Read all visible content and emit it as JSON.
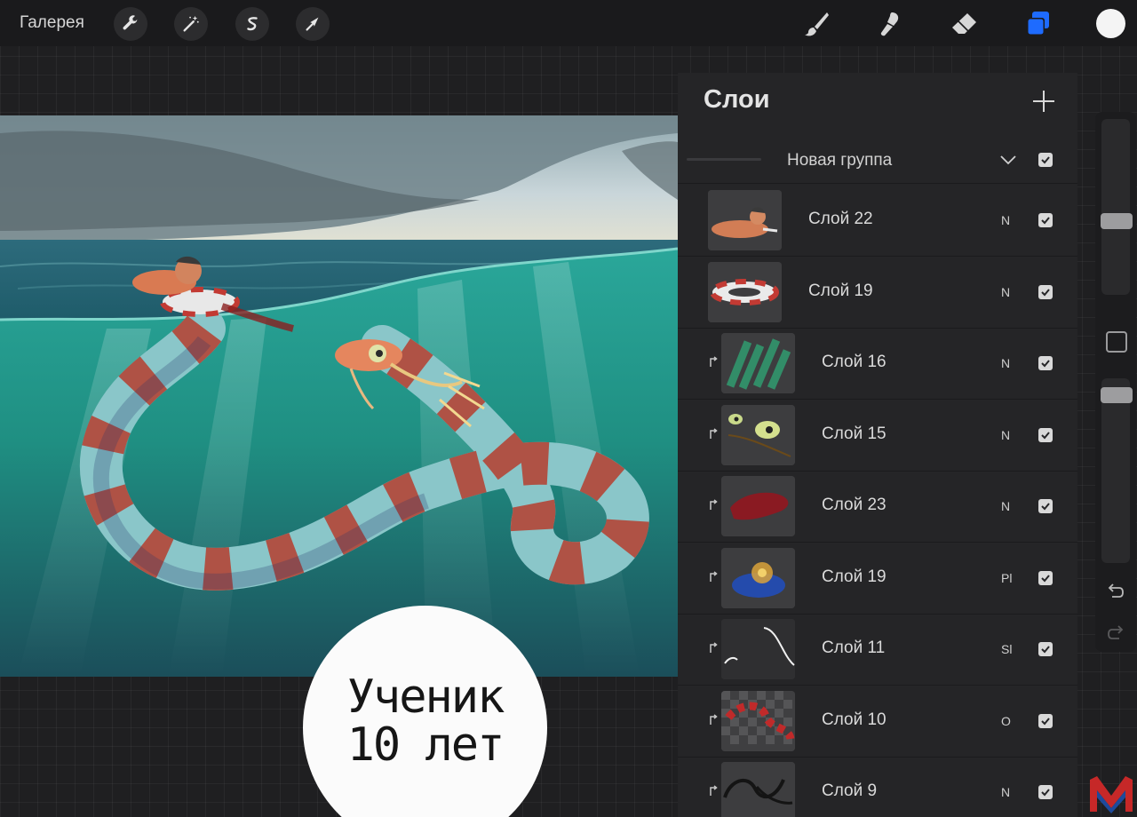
{
  "topbar": {
    "gallery_label": "Галерея",
    "left_tools": [
      "wrench-icon",
      "magic-wand-icon",
      "selection-icon",
      "transform-arrow-icon"
    ],
    "right_tools": [
      "brush-icon",
      "smudge-icon",
      "eraser-icon",
      "layers-icon"
    ],
    "accent_color": "#1e6bff",
    "active_color": "#f4f4f4"
  },
  "stamp": {
    "line1": "Ученик",
    "line2": "10 лет"
  },
  "layers": {
    "title": "Слои",
    "add_icon": "plus-icon",
    "group": {
      "name": "Новая группа",
      "visible": true
    },
    "items": [
      {
        "name": "Слой 22",
        "blend": "N",
        "visible": true,
        "clipped": false,
        "thumb": "swimmer"
      },
      {
        "name": "Слой 19",
        "blend": "N",
        "visible": true,
        "clipped": false,
        "thumb": "lifebuoy"
      },
      {
        "name": "Слой 16",
        "blend": "N",
        "visible": true,
        "clipped": true,
        "thumb": "green-strokes"
      },
      {
        "name": "Слой 15",
        "blend": "N",
        "visible": true,
        "clipped": true,
        "thumb": "eyes"
      },
      {
        "name": "Слой 23",
        "blend": "N",
        "visible": true,
        "clipped": true,
        "thumb": "red-blob"
      },
      {
        "name": "Слой 19",
        "blend": "Pl",
        "visible": true,
        "clipped": true,
        "thumb": "glow"
      },
      {
        "name": "Слой 11",
        "blend": "Sl",
        "visible": true,
        "clipped": true,
        "thumb": "white-lines"
      },
      {
        "name": "Слой 10",
        "blend": "O",
        "visible": true,
        "clipped": true,
        "thumb": "checker-red"
      },
      {
        "name": "Слой 9",
        "blend": "N",
        "visible": true,
        "clipped": true,
        "thumb": "dark-lines"
      }
    ]
  },
  "sidebar": {
    "brush_size_level": 0.3,
    "opacity_level": 0.95,
    "modify_icon": "square-icon",
    "undo_icon": "undo-icon",
    "redo_icon": "redo-icon"
  },
  "watermark": {
    "letter": "M"
  }
}
